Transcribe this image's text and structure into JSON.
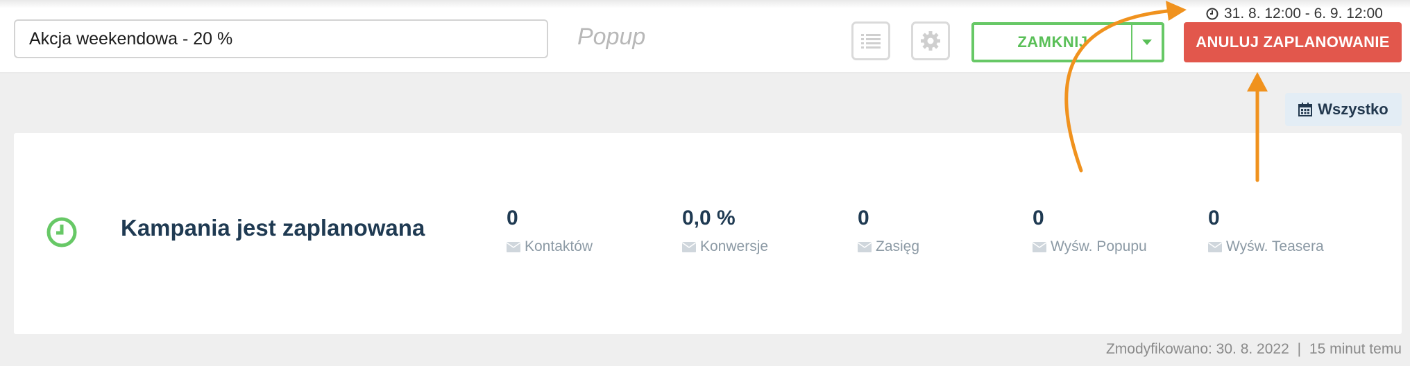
{
  "header": {
    "campaign_name": "Akcja weekendowa - 20 %",
    "campaign_type": "Popup",
    "close_label": "ZAMKNIJ",
    "cancel_label": "ANULUJ ZAPLANOWANIE",
    "schedule_range": "31. 8. 12:00 - 6. 9. 12:00"
  },
  "filter": {
    "all_label": "Wszystko"
  },
  "status": {
    "title": "Kampania jest zaplanowana"
  },
  "stats": [
    {
      "value": "0",
      "label": "Kontaktów"
    },
    {
      "value": "0,0 %",
      "label": "Konwersje"
    },
    {
      "value": "0",
      "label": "Zasięg"
    },
    {
      "value": "0",
      "label": "Wyśw. Popupu"
    },
    {
      "value": "0",
      "label": "Wyśw. Teasera"
    }
  ],
  "footer": {
    "modified": "Zmodyfikowano: 30. 8. 2022",
    "separator": "|",
    "ago": "15 minut temu"
  },
  "colors": {
    "green": "#67c866",
    "red": "#e2574c",
    "annotation_orange": "#f0921e",
    "dark_text": "#1f3a52"
  },
  "icons": {
    "list": "list-icon",
    "settings": "gear-icon",
    "caret": "chevron-down-icon",
    "clock": "clock-icon",
    "calendar": "calendar-icon",
    "envelope": "envelope-icon",
    "status": "clock-icon"
  }
}
